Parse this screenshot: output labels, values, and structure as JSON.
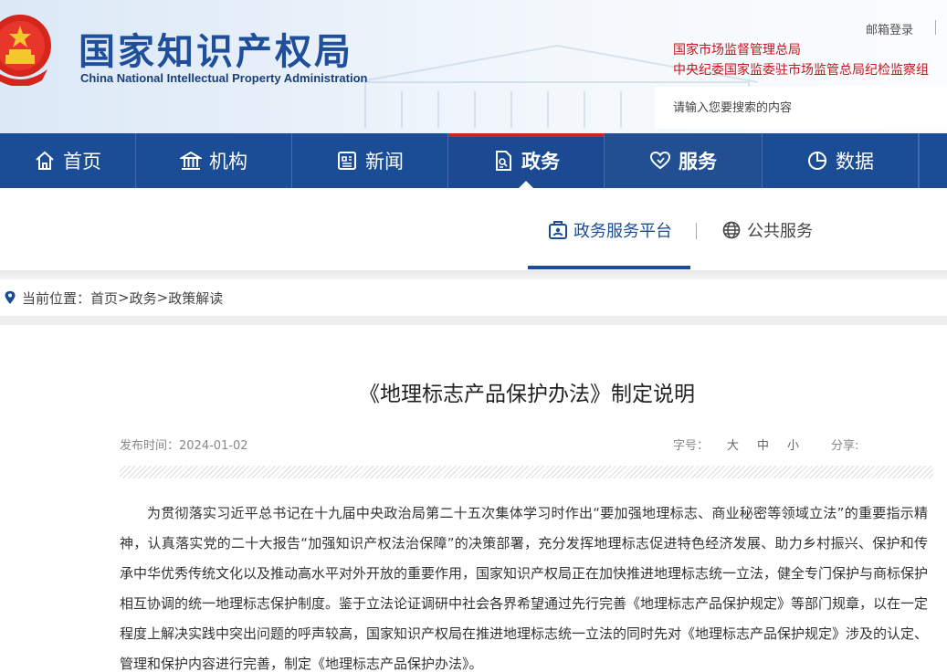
{
  "header": {
    "site_name": "国家知识产权局",
    "site_name_en": "China National Intellectual Property Administration",
    "mail_login": "邮箱登录",
    "links": [
      "国家市场监督管理总局",
      "中央纪委国家监委驻市场监管总局纪检监察组"
    ],
    "search_placeholder": "请输入您要搜索的内容"
  },
  "nav": {
    "items": [
      {
        "label": "首页",
        "icon": "home-icon"
      },
      {
        "label": "机构",
        "icon": "building-icon"
      },
      {
        "label": "新闻",
        "icon": "newspaper-icon"
      },
      {
        "label": "政务",
        "icon": "document-icon"
      },
      {
        "label": "服务",
        "icon": "heart-hand-icon"
      },
      {
        "label": "数据",
        "icon": "pie-chart-icon"
      }
    ],
    "active": "政务"
  },
  "subnav": {
    "items": [
      {
        "label": "政务服务平台",
        "icon": "service-platform-icon"
      },
      {
        "label": "公共服务",
        "icon": "globe-icon"
      }
    ]
  },
  "breadcrumb": {
    "prefix": "当前位置：",
    "items": [
      "首页",
      "政务",
      "政策解读"
    ],
    "separator": ">"
  },
  "article": {
    "title": "《地理标志产品保护办法》制定说明",
    "publish_label": "发布时间：",
    "publish_date": "2024-01-02",
    "font_size_label": "字号：",
    "font_sizes": [
      "大",
      "中",
      "小"
    ],
    "share_label": "分享:",
    "paragraph": "为贯彻落实习近平总书记在十九届中央政治局第二十五次集体学习时作出“要加强地理标志、商业秘密等领域立法”的重要指示精神，认真落实党的二十大报告“加强知识产权法治保障”的决策部署，充分发挥地理标志促进特色经济发展、助力乡村振兴、保护和传承中华优秀传统文化以及推动高水平对外开放的重要作用，国家知识产权局正在加快推进地理标志统一立法，健全专门保护与商标保护相互协调的统一地理标志保护制度。鉴于立法论证调研中社会各界希望通过先行完善《地理标志产品保护规定》等部门规章，以在一定程度上解决实践中突出问题的呼声较高，国家知识产权局在推进地理标志统一立法的同时先对《地理标志产品保护规定》涉及的认定、管理和保护内容进行完善，制定《地理标志产品保护办法》。"
  },
  "colors": {
    "nav_bg": "#1a4d96",
    "accent_red": "#c8262b",
    "brand_blue": "#1f4e9a"
  }
}
